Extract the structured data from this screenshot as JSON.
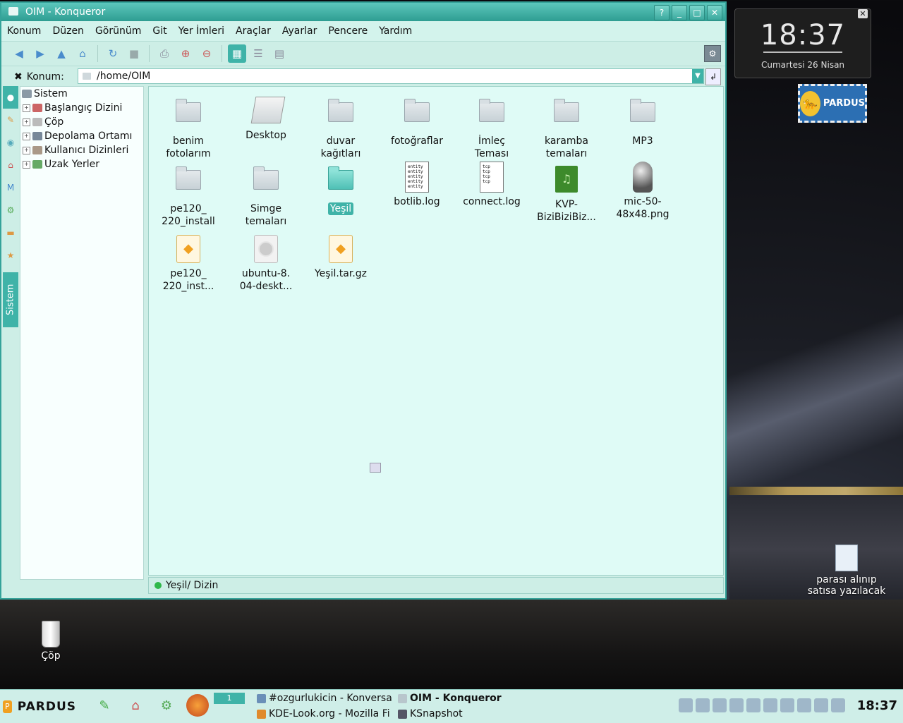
{
  "window": {
    "title": "OIM - Konqueror",
    "buttons": [
      "?",
      "_",
      "□",
      "✕"
    ]
  },
  "menubar": [
    "Konum",
    "Düzen",
    "Görünüm",
    "Git",
    "Yer İmleri",
    "Araçlar",
    "Ayarlar",
    "Pencere",
    "Yardım"
  ],
  "location": {
    "label": "Konum:",
    "value": "/home/OIM"
  },
  "sidebar": {
    "tab_label": "Sistem",
    "tree": [
      {
        "label": "Sistem",
        "root": true
      },
      {
        "label": "Başlangıç Dizini"
      },
      {
        "label": "Çöp"
      },
      {
        "label": "Depolama Ortamı"
      },
      {
        "label": "Kullanıcı Dizinleri"
      },
      {
        "label": "Uzak Yerler"
      }
    ]
  },
  "files": [
    {
      "name": "benim fotolarım",
      "l1": "benim",
      "l2": "fotolarım",
      "type": "folder"
    },
    {
      "name": "Desktop",
      "l1": "Desktop",
      "l2": "",
      "type": "desktop"
    },
    {
      "name": "duvar kağıtları",
      "l1": "duvar",
      "l2": "kağıtları",
      "type": "folder"
    },
    {
      "name": "fotoğraflar",
      "l1": "fotoğraflar",
      "l2": "",
      "type": "folder"
    },
    {
      "name": "İmleç Teması",
      "l1": "İmleç",
      "l2": "Teması",
      "type": "folder"
    },
    {
      "name": "karamba temaları",
      "l1": "karamba",
      "l2": "temaları",
      "type": "folder"
    },
    {
      "name": "MP3",
      "l1": "MP3",
      "l2": "",
      "type": "folder"
    },
    {
      "name": "pe120_220_install",
      "l1": "pe120_",
      "l2": "220_install",
      "type": "folder"
    },
    {
      "name": "Simge temaları",
      "l1": "Simge",
      "l2": "temaları",
      "type": "folder"
    },
    {
      "name": "Yeşil",
      "l1": "Yeşil",
      "l2": "",
      "type": "folder-selected"
    },
    {
      "name": "botlib.log",
      "l1": "botlib.log",
      "l2": "",
      "type": "doc-entity"
    },
    {
      "name": "connect.log",
      "l1": "connect.log",
      "l2": "",
      "type": "doc-tcp"
    },
    {
      "name": "KVP-BiziBiziBiz...",
      "l1": "KVP-",
      "l2": "BiziBiziBiz...",
      "type": "audio"
    },
    {
      "name": "mic-50-48x48.png",
      "l1": "mic-50-",
      "l2": "48x48.png",
      "type": "mic"
    },
    {
      "name": "pe120_220_inst...",
      "l1": "pe120_",
      "l2": "220_inst...",
      "type": "package"
    },
    {
      "name": "ubuntu-8.04-deskt...",
      "l1": "ubuntu-8.",
      "l2": "04-deskt...",
      "type": "disc"
    },
    {
      "name": "Yeşil.tar.gz",
      "l1": "Yeşil.tar.gz",
      "l2": "",
      "type": "package"
    }
  ],
  "doc_lines": {
    "entity": "entity",
    "tcp": "tcp"
  },
  "status": {
    "text": "Yeşil/  Dizin"
  },
  "clock_widget": {
    "time": "18:37",
    "date": "Cumartesi 26 Nisan"
  },
  "desktop": {
    "trash_label": "Çöp",
    "note_l1": "parası alınıp",
    "note_l2": "satısa yazılacak",
    "stamp_text": "PARDUS"
  },
  "taskbar": {
    "menu_label": "PARDUS",
    "pager": "1",
    "tasks": [
      {
        "label": "#ozgurlukicin - Konversa"
      },
      {
        "label": "OIM - Konqueror",
        "active": true
      },
      {
        "label": "KDE-Look.org - Mozilla Fi"
      },
      {
        "label": "KSnapshot"
      }
    ],
    "clock": "18:37"
  },
  "colors": {
    "accent": "#3fb3a8",
    "window_bg": "#cdeee6",
    "view_bg": "#dffbf6"
  }
}
